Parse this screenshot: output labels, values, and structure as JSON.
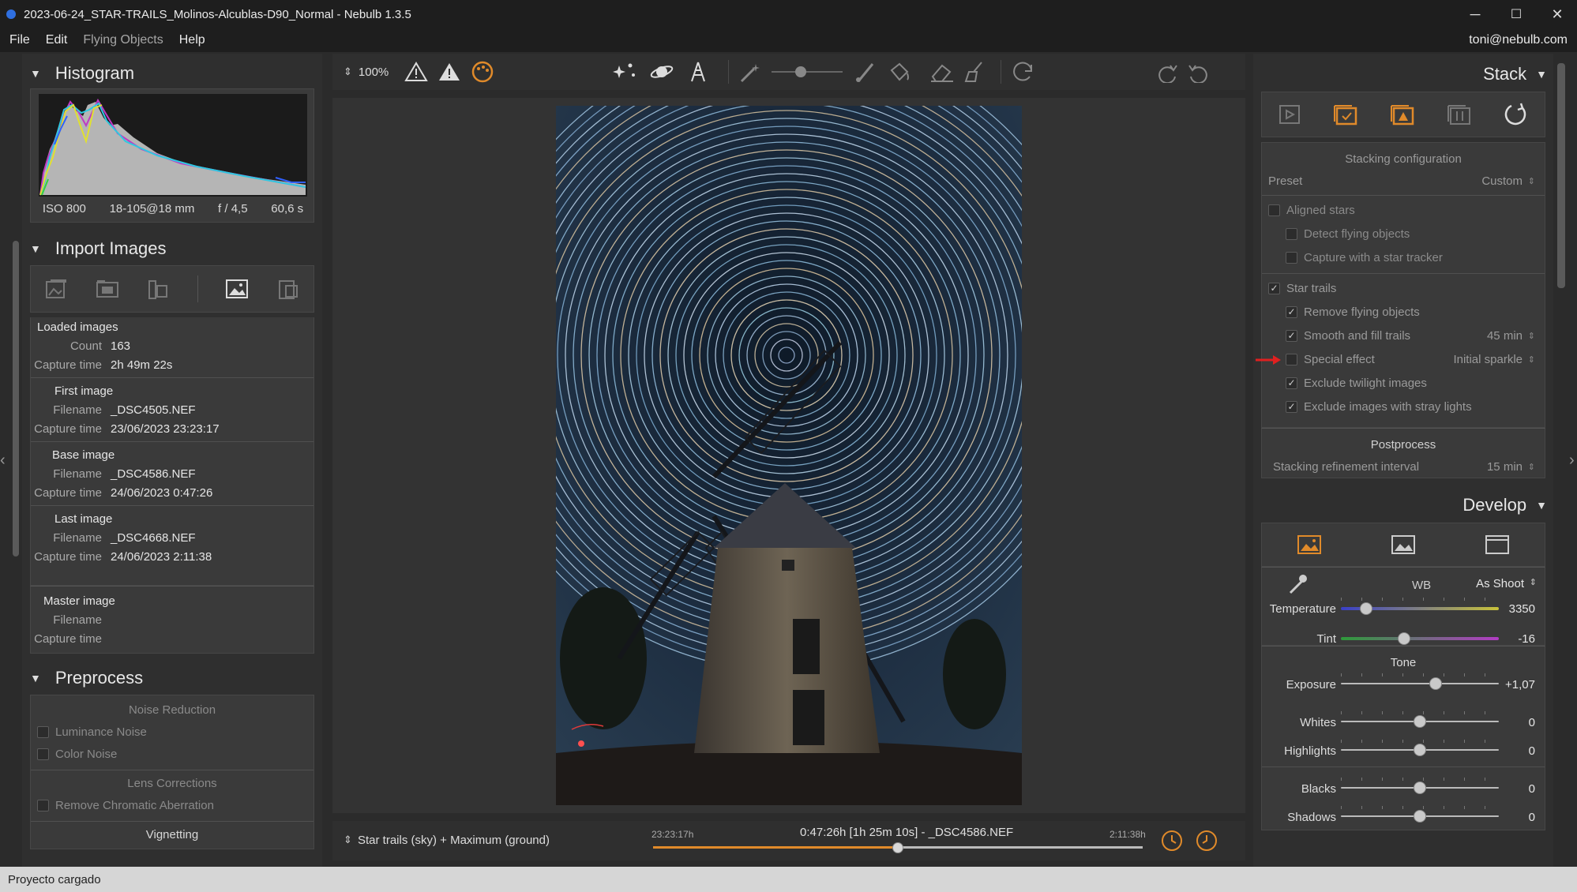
{
  "window": {
    "title": "2023-06-24_STAR-TRAILS_Molinos-Alcublas-D90_Normal - Nebulb 1.3.5",
    "minimize": "─",
    "maximize": "☐",
    "close": "✕"
  },
  "menu": {
    "items": [
      "File",
      "Edit",
      "Flying Objects",
      "Help"
    ],
    "user": "toni@nebulb.com"
  },
  "histogram": {
    "title": "Histogram",
    "iso": "ISO 800",
    "lens": "18-105@18 mm",
    "aperture": "f / 4,5",
    "exposure": "60,6 s"
  },
  "import": {
    "title": "Import Images",
    "loaded_label": "Loaded images",
    "count_label": "Count",
    "count": "163",
    "capture_label": "Capture time",
    "capture_time": "2h 49m 22s",
    "first": {
      "title": "First image",
      "filename_label": "Filename",
      "filename": "_DSC4505.NEF",
      "capture_label": "Capture time",
      "capture": "23/06/2023 23:23:17"
    },
    "base": {
      "title": "Base image",
      "filename_label": "Filename",
      "filename": "_DSC4586.NEF",
      "capture_label": "Capture time",
      "capture": "24/06/2023 0:47:26"
    },
    "last": {
      "title": "Last image",
      "filename_label": "Filename",
      "filename": "_DSC4668.NEF",
      "capture_label": "Capture time",
      "capture": "24/06/2023 2:11:38"
    },
    "master": {
      "title": "Master image",
      "filename_label": "Filename",
      "capture_label": "Capture time"
    }
  },
  "preprocess": {
    "title": "Preprocess",
    "noise_title": "Noise Reduction",
    "luminance": "Luminance Noise",
    "color": "Color Noise",
    "lens_title": "Lens Corrections",
    "chromatic": "Remove Chromatic Aberration",
    "vignetting": "Vignetting"
  },
  "toolbar": {
    "zoom": "100%"
  },
  "footer": {
    "mode": "Star trails (sky) + Maximum (ground)",
    "start_time": "23:23:17h",
    "current": "0:47:26h [1h 25m 10s] - _DSC4586.NEF",
    "end_time": "2:11:38h",
    "position": 0.5
  },
  "stack": {
    "title": "Stack",
    "config_title": "Stacking configuration",
    "preset_label": "Preset",
    "preset_value": "Custom",
    "aligned": "Aligned stars",
    "detect_flying": "Detect flying objects",
    "capture_tracker": "Capture with a star tracker",
    "star_trails": "Star trails",
    "remove_flying": "Remove flying objects",
    "smooth": "Smooth and fill trails",
    "smooth_value": "45 min",
    "special": "Special effect",
    "special_value": "Initial sparkle",
    "exclude_twilight": "Exclude twilight images",
    "exclude_stray": "Exclude images with stray lights",
    "post_title": "Postprocess",
    "refine_label": "Stacking refinement interval",
    "refine_value": "15 min"
  },
  "develop": {
    "title": "Develop",
    "wb_label": "WB",
    "wb_value": "As Shoot",
    "temperature_label": "Temperature",
    "temperature_value": "3350",
    "temperature_pos": 0.16,
    "tint_label": "Tint",
    "tint_value": "-16",
    "tint_pos": 0.4,
    "tone_title": "Tone",
    "exposure_label": "Exposure",
    "exposure_value": "+1,07",
    "exposure_pos": 0.6,
    "whites_label": "Whites",
    "whites_value": "0",
    "highlights_label": "Highlights",
    "highlights_value": "0",
    "blacks_label": "Blacks",
    "blacks_value": "0",
    "shadows_label": "Shadows",
    "shadows_value": "0"
  },
  "status": {
    "text": "Proyecto cargado"
  },
  "colors": {
    "accent": "#e08a2a",
    "slider_tint_start": "#2e9a3a",
    "slider_tint_end": "#b23cc4",
    "slider_temp_start": "#3a40c8",
    "slider_temp_end": "#c8c23a"
  }
}
